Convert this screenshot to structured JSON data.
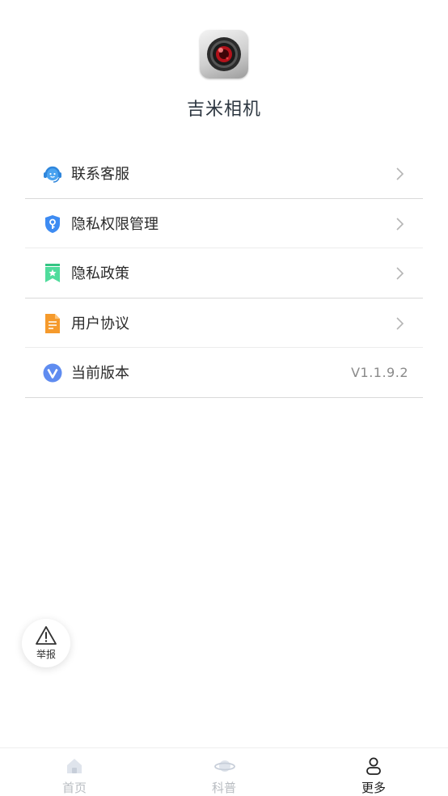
{
  "app": {
    "name": "吉米相机",
    "logo_icon": "camera-lens-icon"
  },
  "menu": {
    "items": [
      {
        "label": "联系客服",
        "icon": "customer-service-icon",
        "color": "#4aa3f0"
      },
      {
        "label": "隐私权限管理",
        "icon": "shield-key-icon",
        "color": "#3d8bf2"
      },
      {
        "label": "隐私政策",
        "icon": "bookmark-star-icon",
        "color": "#3ed08f"
      },
      {
        "label": "用户协议",
        "icon": "document-icon",
        "color": "#f59a2c"
      },
      {
        "label": "当前版本",
        "icon": "version-v-icon",
        "color": "#5f8cf0",
        "value": "V1.1.9.2"
      }
    ]
  },
  "report": {
    "label": "举报",
    "icon": "warning-triangle-icon"
  },
  "tabbar": {
    "tabs": [
      {
        "label": "首页",
        "icon": "home-icon",
        "active": false
      },
      {
        "label": "科普",
        "icon": "planet-icon",
        "active": false
      },
      {
        "label": "更多",
        "icon": "user-icon",
        "active": true
      }
    ]
  }
}
